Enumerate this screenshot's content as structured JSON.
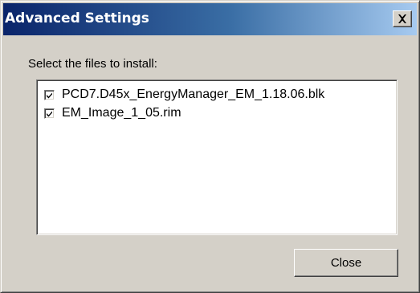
{
  "window": {
    "title": "Advanced Settings",
    "close_glyph": "✕",
    "colors": {
      "titlebar_start": "#0a246a",
      "titlebar_end": "#a6caf0",
      "face": "#d4d0c8"
    }
  },
  "content": {
    "prompt": "Select the files to install:",
    "files": [
      {
        "label": "PCD7.D45x_EnergyManager_EM_1.18.06.blk",
        "checked": true,
        "icon": "checkmark-icon"
      },
      {
        "label": "EM_Image_1_05.rim",
        "checked": true,
        "icon": "checkmark-icon"
      }
    ]
  },
  "buttons": {
    "close_label": "Close"
  }
}
